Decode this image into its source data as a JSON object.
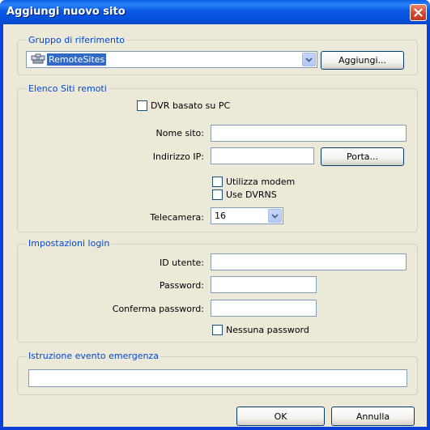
{
  "window": {
    "title": "Aggiungi nuovo sito"
  },
  "groups": {
    "reference_group": {
      "legend": "Gruppo di riferimento",
      "selected": "RemoteSites",
      "add_button": "Aggiungi..."
    },
    "remote_sites": {
      "legend": "Elenco Siti remoti",
      "dvr_pc_checkbox": "DVR basato su PC",
      "site_name_label": "Nome sito:",
      "site_name_value": "",
      "ip_label": "Indirizzo IP:",
      "ip_value": "",
      "port_button": "Porta...",
      "use_modem_checkbox": "Utilizza modem",
      "use_dvrns_checkbox": "Use DVRNS",
      "camera_label": "Telecamera:",
      "camera_selected": "16"
    },
    "login": {
      "legend": "Impostazioni login",
      "user_id_label": "ID utente:",
      "user_id_value": "",
      "password_label": "Password:",
      "password_value": "",
      "confirm_label": "Conferma password:",
      "confirm_value": "",
      "no_password_checkbox": "Nessuna password"
    },
    "emergency": {
      "legend": "Istruzione evento emergenza",
      "value": ""
    }
  },
  "footer": {
    "ok_label": "OK",
    "cancel_label": "Annulla"
  },
  "icons": {
    "close": "close-icon",
    "group": "group-folder-icon",
    "dropdown": "chevron-down-icon"
  },
  "colors": {
    "titlebar": "#0a5ee8",
    "legend": "#0046d5",
    "dialog_bg": "#ece9d8",
    "selection": "#316ac5"
  }
}
